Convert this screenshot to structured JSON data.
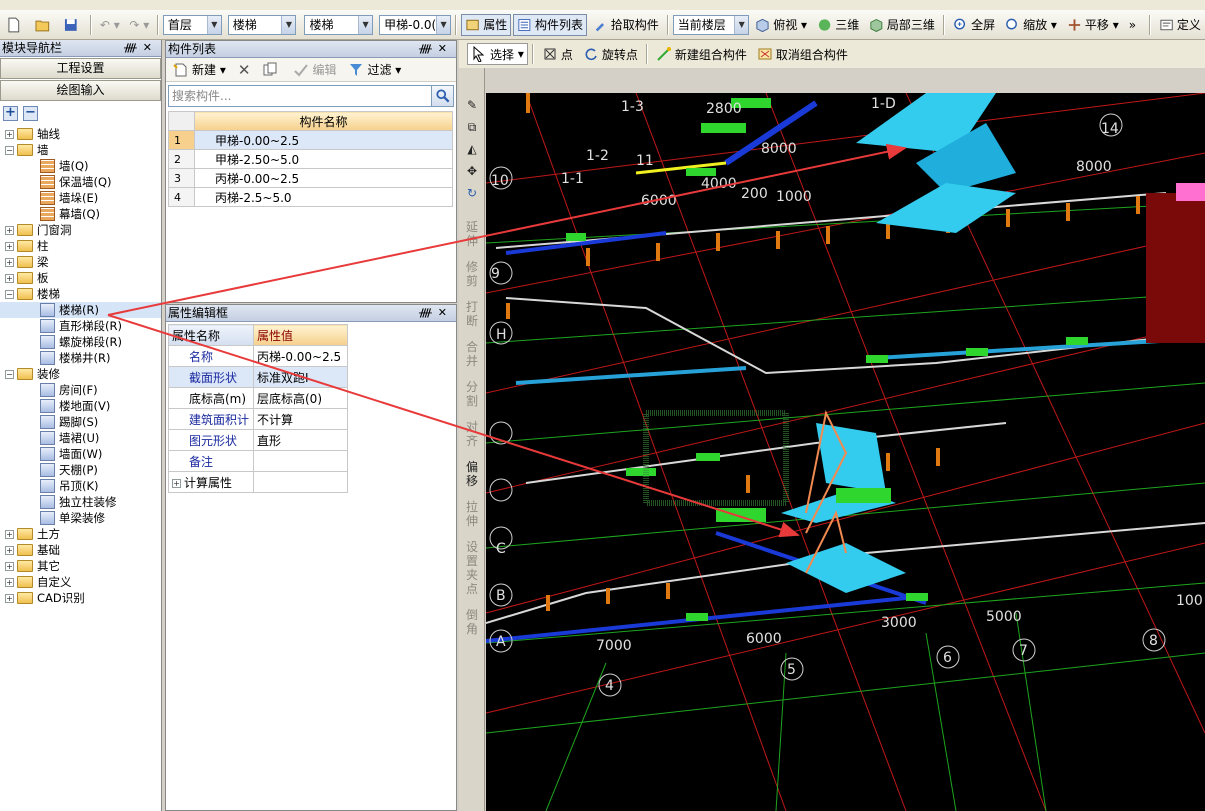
{
  "toolbar": {
    "floor": "首层",
    "category": "楼梯",
    "subcategory": "楼梯",
    "component": "甲梯-0.0(",
    "attr_btn": "属性",
    "complist_btn": "构件列表",
    "pick_btn": "拾取构件",
    "layer": "当前楼层",
    "view_btn": "俯视",
    "three_d": "三维",
    "local_3d": "局部三维",
    "fullscreen": "全屏",
    "zoom": "缩放",
    "pan": "平移",
    "more": "»",
    "define": "定义"
  },
  "nav": {
    "title": "模块导航栏",
    "project_settings": "工程设置",
    "drawing_input": "绘图输入",
    "tree": [
      {
        "label": "轴线",
        "type": "folder",
        "level": 0,
        "expanded": false
      },
      {
        "label": "墙",
        "type": "folder",
        "level": 0,
        "expanded": true
      },
      {
        "label": "墙(Q)",
        "type": "leaf",
        "level": 1,
        "icon": "wall-icon"
      },
      {
        "label": "保温墙(Q)",
        "type": "leaf",
        "level": 1,
        "icon": "insulation-wall-icon"
      },
      {
        "label": "墙垛(E)",
        "type": "leaf",
        "level": 1,
        "icon": "wall-pier-icon"
      },
      {
        "label": "幕墙(Q)",
        "type": "leaf",
        "level": 1,
        "icon": "curtain-wall-icon"
      },
      {
        "label": "门窗洞",
        "type": "folder",
        "level": 0,
        "expanded": false
      },
      {
        "label": "柱",
        "type": "folder",
        "level": 0,
        "expanded": false
      },
      {
        "label": "梁",
        "type": "folder",
        "level": 0,
        "expanded": false
      },
      {
        "label": "板",
        "type": "folder",
        "level": 0,
        "expanded": false
      },
      {
        "label": "楼梯",
        "type": "folder",
        "level": 0,
        "expanded": true
      },
      {
        "label": "楼梯(R)",
        "type": "leaf",
        "level": 1,
        "icon": "stair-icon",
        "selected": true
      },
      {
        "label": "直形梯段(R)",
        "type": "leaf",
        "level": 1,
        "icon": "straight-flight-icon"
      },
      {
        "label": "螺旋梯段(R)",
        "type": "leaf",
        "level": 1,
        "icon": "spiral-flight-icon"
      },
      {
        "label": "楼梯井(R)",
        "type": "leaf",
        "level": 1,
        "icon": "stairwell-icon"
      },
      {
        "label": "装修",
        "type": "folder",
        "level": 0,
        "expanded": true
      },
      {
        "label": "房间(F)",
        "type": "leaf",
        "level": 1,
        "icon": "room-icon"
      },
      {
        "label": "楼地面(V)",
        "type": "leaf",
        "level": 1,
        "icon": "floor-icon"
      },
      {
        "label": "踢脚(S)",
        "type": "leaf",
        "level": 1,
        "icon": "skirting-icon"
      },
      {
        "label": "墙裙(U)",
        "type": "leaf",
        "level": 1,
        "icon": "dado-icon"
      },
      {
        "label": "墙面(W)",
        "type": "leaf",
        "level": 1,
        "icon": "wall-finish-icon"
      },
      {
        "label": "天棚(P)",
        "type": "leaf",
        "level": 1,
        "icon": "ceiling-icon"
      },
      {
        "label": "吊顶(K)",
        "type": "leaf",
        "level": 1,
        "icon": "suspended-ceiling-icon"
      },
      {
        "label": "独立柱装修",
        "type": "leaf",
        "level": 1,
        "icon": "column-finish-icon"
      },
      {
        "label": "单梁装修",
        "type": "leaf",
        "level": 1,
        "icon": "beam-finish-icon"
      },
      {
        "label": "土方",
        "type": "folder",
        "level": 0,
        "expanded": false
      },
      {
        "label": "基础",
        "type": "folder",
        "level": 0,
        "expanded": false
      },
      {
        "label": "其它",
        "type": "folder",
        "level": 0,
        "expanded": false
      },
      {
        "label": "自定义",
        "type": "folder",
        "level": 0,
        "expanded": false
      },
      {
        "label": "CAD识别",
        "type": "folder",
        "level": 0,
        "expanded": false
      }
    ]
  },
  "complist": {
    "title": "构件列表",
    "new_btn": "新建",
    "edit_btn": "编辑",
    "filter_btn": "过滤",
    "search_placeholder": "搜索构件...",
    "col_header": "构件名称",
    "rows": [
      {
        "num": "1",
        "name": "甲梯-0.00~2.5",
        "selected": true
      },
      {
        "num": "2",
        "name": "甲梯-2.50~5.0",
        "selected": false
      },
      {
        "num": "3",
        "name": "丙梯-0.00~2.5",
        "selected": false
      },
      {
        "num": "4",
        "name": "丙梯-2.5~5.0",
        "selected": false
      }
    ]
  },
  "props": {
    "title": "属性编辑框",
    "col_name": "属性名称",
    "col_value": "属性值",
    "rows": [
      {
        "name": "名称",
        "value": "丙梯-0.00~2.5",
        "blue": true
      },
      {
        "name": "截面形状",
        "value": "标准双跑I",
        "blue": true,
        "selected": true
      },
      {
        "name": "底标高(m)",
        "value": "层底标高(0)",
        "blue": false
      },
      {
        "name": "建筑面积计",
        "value": "不计算",
        "blue": true
      },
      {
        "name": "图元形状",
        "value": "直形",
        "blue": true
      },
      {
        "name": "备注",
        "value": "",
        "blue": true
      },
      {
        "name": "计算属性",
        "value": "",
        "blue": false,
        "expandable": true
      }
    ]
  },
  "drawbar": {
    "select": "选择",
    "point": "点",
    "rotate_point": "旋转点",
    "new_group": "新建组合构件",
    "cancel_group": "取消组合构件"
  },
  "vtool": [
    "延伸",
    "修剪",
    "打断",
    "合并",
    "分割",
    "对齐",
    "偏移",
    "拉伸",
    "设置夹点",
    "倒角"
  ],
  "viewport": {
    "labels": [
      "1-3",
      "1-D",
      "1-2",
      "11",
      "1-1",
      "10",
      "9",
      "14",
      "2800",
      "8000",
      "6000",
      "4000",
      "8000",
      "6000",
      "5000",
      "7000",
      "3000",
      "100",
      "200",
      "1000"
    ],
    "axis_letters": [
      "H",
      "C",
      "B",
      "A"
    ],
    "axis_numbers": [
      "4",
      "5",
      "6",
      "7",
      "8"
    ]
  },
  "colors": {
    "viewport_bg": "#000000",
    "grid_red": "#ff2020",
    "grid_green": "#22c022",
    "stair_cyan": "#33ccee",
    "annotation_red": "#e83a3a"
  }
}
